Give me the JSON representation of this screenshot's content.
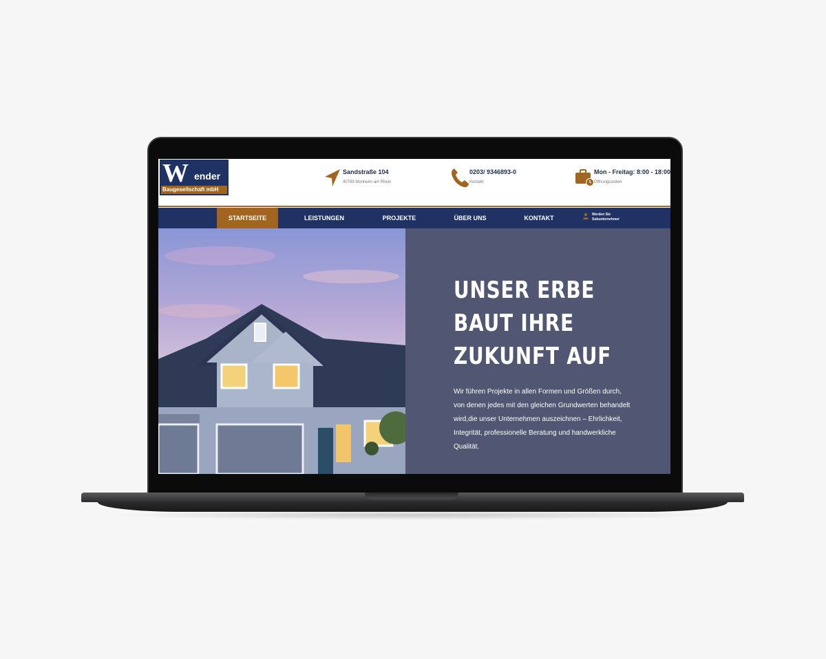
{
  "header": {
    "logo": {
      "main": "Wender",
      "letter": "W",
      "rest": "ender",
      "subtitle": "Baugesellschaft mbH"
    },
    "address": {
      "line1": "Sandstraße 104",
      "line2": "40789 Monheim am Rhein",
      "icon": "location-arrow-icon"
    },
    "phone": {
      "line1": "0203/ 9346893-0",
      "line2": "Kontakt",
      "icon": "phone-icon"
    },
    "hours": {
      "line1": "Mon - Freitag: 8:00 - 18:00",
      "line2": "Öffnungszeiten",
      "icon": "briefcase-clock-icon"
    }
  },
  "nav": {
    "items": [
      {
        "label": "STARTSEITE",
        "active": true
      },
      {
        "label": "LEISTUNGEN",
        "active": false
      },
      {
        "label": "PROJEKTE",
        "active": false
      },
      {
        "label": "ÜBER UNS",
        "active": false
      },
      {
        "label": "KONTAKT",
        "active": false
      }
    ],
    "extra": {
      "line1": "Werden Sie",
      "line2": "Subunternehmer",
      "icon": "user-icon"
    }
  },
  "hero": {
    "headline": [
      "UNSER ERBE",
      "BAUT IHRE",
      "ZUKUNFT AUF"
    ],
    "description": "Wir führen Projekte in allen Formen und Größen durch, von denen jedes mit den gleichen Grundwerten behandelt wird,die unser Unternehmen auszeichnen – Ehrlichkeit, Integrität, professionelle Beratung und handwerkliche Qualität."
  },
  "colors": {
    "nav": "#1f3263",
    "accent": "#a2651f",
    "panel": "#515772",
    "logo": "#1e3264"
  }
}
